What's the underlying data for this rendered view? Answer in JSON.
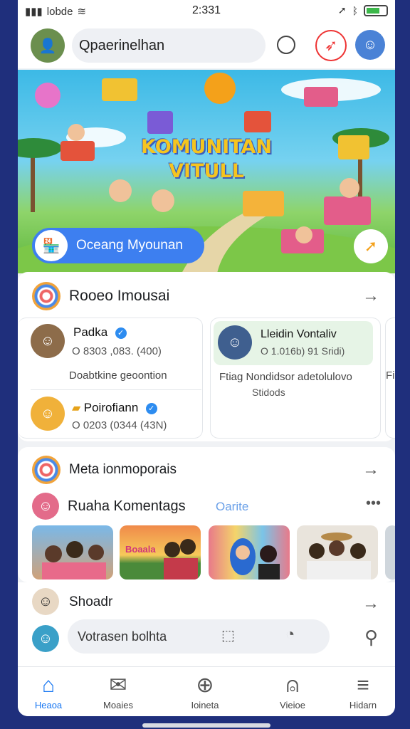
{
  "status_bar": {
    "carrier": "lobde",
    "time": "2:331"
  },
  "header": {
    "search_placeholder": "Qpaerinelhan"
  },
  "banner": {
    "title_line1": "KOMUNITAN",
    "title_line2": "VITULL",
    "button_label": "Oceang Myounan"
  },
  "section1": {
    "title": "Rooeo Imousai",
    "people": [
      {
        "name": "Padka",
        "stat": "O 8303 ,083. (400)"
      },
      {
        "name": "Poirofiann",
        "stat": "O 0203 (0344 (43N)"
      }
    ],
    "left_caption": "Doabtkine geoontion",
    "featured": {
      "name": "Lleidin Vontaliv",
      "stat": "O 1.016b) 91 Sridi)",
      "caption_line1": "Ftiag Nondidsor adetolulovo",
      "caption_line2": "Stidods",
      "peek_label": "Fi"
    }
  },
  "section2": {
    "title": "Meta ionmoporais",
    "group_title": "Ruaha Komentags",
    "group_badge": "Oarite",
    "photo_labels": [
      "",
      "Boaala",
      "",
      ""
    ]
  },
  "section3": {
    "title": "Shoadr",
    "composer_placeholder": "Votrasen bolhta"
  },
  "bottom_nav": [
    "Heaoa",
    "Moaies",
    "Ioineta",
    "Vieioe",
    "Hidarn"
  ],
  "colors": {
    "accent": "#3d7ff0",
    "banner_title": "#f5c51f",
    "nav_active": "#1877f2",
    "page_bg": "#1f2f7c"
  }
}
